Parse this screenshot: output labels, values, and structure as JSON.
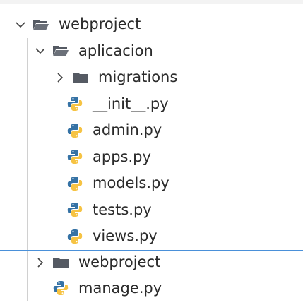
{
  "explorer": {
    "root": {
      "label": "webproject",
      "expanded": true
    },
    "app": {
      "label": "aplicacion",
      "expanded": true
    },
    "migrations": {
      "label": "migrations",
      "expanded": false
    },
    "files_in_app": [
      {
        "label": "__init__.py"
      },
      {
        "label": "admin.py"
      },
      {
        "label": "apps.py"
      },
      {
        "label": "models.py"
      },
      {
        "label": "tests.py"
      },
      {
        "label": "views.py"
      }
    ],
    "inner_project": {
      "label": "webproject",
      "expanded": false
    },
    "manage": {
      "label": "manage.py"
    }
  },
  "colors": {
    "folder": "#555a63",
    "python_blue": "#3572a5",
    "python_yellow": "#f6c343",
    "selection_border": "#4a90d9",
    "text": "#2b2b2b"
  }
}
